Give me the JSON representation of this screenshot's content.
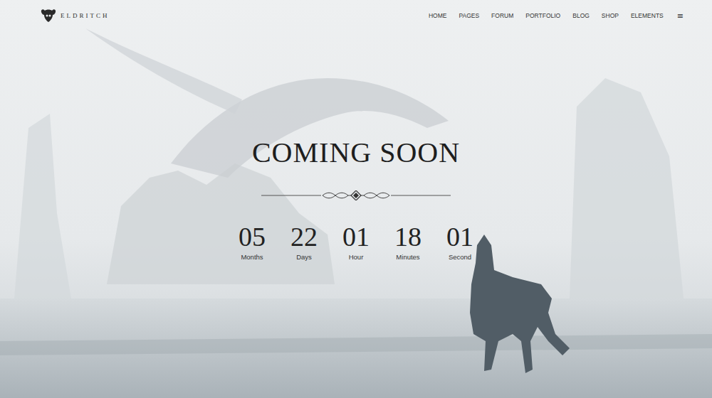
{
  "logo": {
    "text": "ELDRITCH"
  },
  "nav": {
    "items": [
      {
        "label": "HOME"
      },
      {
        "label": "PAGES"
      },
      {
        "label": "FORUM"
      },
      {
        "label": "PORTFOLIO"
      },
      {
        "label": "BLOG"
      },
      {
        "label": "SHOP"
      },
      {
        "label": "ELEMENTS"
      }
    ],
    "menu_icon": "≡"
  },
  "hero": {
    "title": "COMING SOON",
    "countdown": [
      {
        "value": "05",
        "unit": "Months"
      },
      {
        "value": "22",
        "unit": "Days"
      },
      {
        "value": "01",
        "unit": "Hour"
      },
      {
        "value": "18",
        "unit": "Minutes"
      },
      {
        "value": "01",
        "unit": "Second"
      }
    ]
  }
}
